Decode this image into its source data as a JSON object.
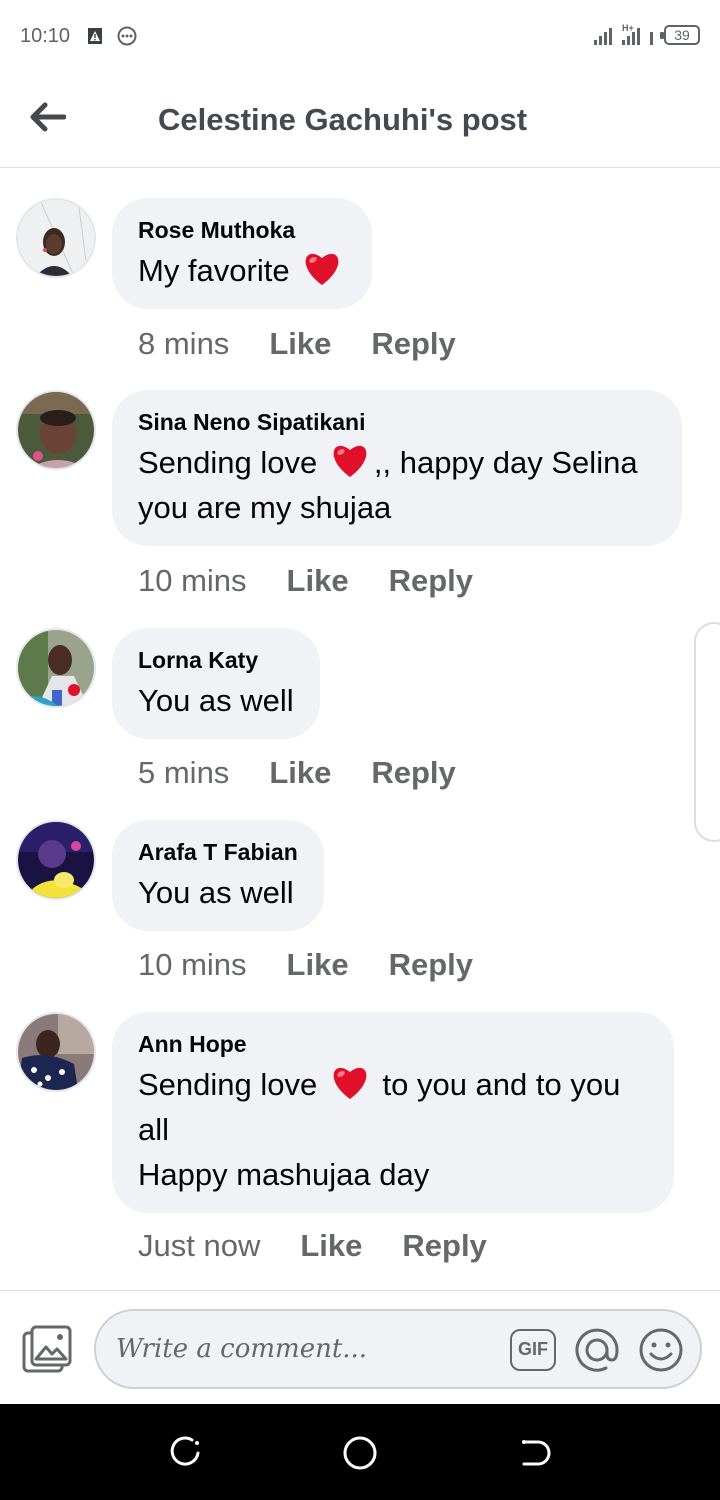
{
  "status_bar": {
    "time": "10:10",
    "battery": "39",
    "icons": [
      "warning-icon",
      "more-dots-icon",
      "signal-icon",
      "battery-icon"
    ]
  },
  "header": {
    "title": "Celestine Gachuhi's post",
    "back_icon": "arrow-left-icon"
  },
  "comments": [
    {
      "author": "Rose Muthoka",
      "text_before": "My favorite ",
      "text_after": "",
      "time": "8 mins",
      "like": "Like",
      "reply": "Reply"
    },
    {
      "author": "Sina Neno Sipatikani",
      "text_before": "Sending love ",
      "text_after": ",, happy day Selina you are my shujaa",
      "time": "10 mins",
      "like": "Like",
      "reply": "Reply"
    },
    {
      "author": "Lorna Katy",
      "text_before": "You as well",
      "text_after": "",
      "time": "5 mins",
      "like": "Like",
      "reply": "Reply"
    },
    {
      "author": "Arafa T Fabian",
      "text_before": "You as well",
      "text_after": "",
      "time": "10 mins",
      "like": "Like",
      "reply": "Reply"
    },
    {
      "author": "Ann Hope",
      "text_before": "Sending love ",
      "text_after": " to you and to you all",
      "text_line2": "Happy mashujaa day",
      "time": "Just now",
      "like": "Like",
      "reply": "Reply"
    }
  ],
  "composer": {
    "placeholder": "Write a comment...",
    "gif_label": "GIF",
    "icons": [
      "photo-icon",
      "gif-icon",
      "at-icon",
      "emoji-icon"
    ]
  },
  "colors": {
    "bubble": "#f0f2f5",
    "meta_text": "#65676b",
    "heart": "#e0102a",
    "nav_bar": "#000000"
  }
}
